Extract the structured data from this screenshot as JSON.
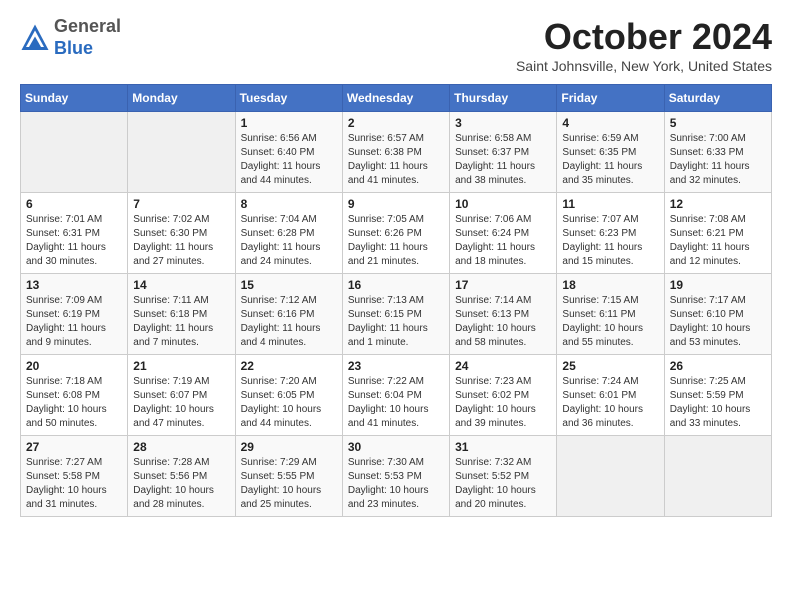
{
  "header": {
    "logo_line1": "General",
    "logo_line2": "Blue",
    "month_title": "October 2024",
    "location": "Saint Johnsville, New York, United States"
  },
  "weekdays": [
    "Sunday",
    "Monday",
    "Tuesday",
    "Wednesday",
    "Thursday",
    "Friday",
    "Saturday"
  ],
  "weeks": [
    [
      {
        "day": "",
        "sunrise": "",
        "sunset": "",
        "daylight": ""
      },
      {
        "day": "",
        "sunrise": "",
        "sunset": "",
        "daylight": ""
      },
      {
        "day": "1",
        "sunrise": "Sunrise: 6:56 AM",
        "sunset": "Sunset: 6:40 PM",
        "daylight": "Daylight: 11 hours and 44 minutes."
      },
      {
        "day": "2",
        "sunrise": "Sunrise: 6:57 AM",
        "sunset": "Sunset: 6:38 PM",
        "daylight": "Daylight: 11 hours and 41 minutes."
      },
      {
        "day": "3",
        "sunrise": "Sunrise: 6:58 AM",
        "sunset": "Sunset: 6:37 PM",
        "daylight": "Daylight: 11 hours and 38 minutes."
      },
      {
        "day": "4",
        "sunrise": "Sunrise: 6:59 AM",
        "sunset": "Sunset: 6:35 PM",
        "daylight": "Daylight: 11 hours and 35 minutes."
      },
      {
        "day": "5",
        "sunrise": "Sunrise: 7:00 AM",
        "sunset": "Sunset: 6:33 PM",
        "daylight": "Daylight: 11 hours and 32 minutes."
      }
    ],
    [
      {
        "day": "6",
        "sunrise": "Sunrise: 7:01 AM",
        "sunset": "Sunset: 6:31 PM",
        "daylight": "Daylight: 11 hours and 30 minutes."
      },
      {
        "day": "7",
        "sunrise": "Sunrise: 7:02 AM",
        "sunset": "Sunset: 6:30 PM",
        "daylight": "Daylight: 11 hours and 27 minutes."
      },
      {
        "day": "8",
        "sunrise": "Sunrise: 7:04 AM",
        "sunset": "Sunset: 6:28 PM",
        "daylight": "Daylight: 11 hours and 24 minutes."
      },
      {
        "day": "9",
        "sunrise": "Sunrise: 7:05 AM",
        "sunset": "Sunset: 6:26 PM",
        "daylight": "Daylight: 11 hours and 21 minutes."
      },
      {
        "day": "10",
        "sunrise": "Sunrise: 7:06 AM",
        "sunset": "Sunset: 6:24 PM",
        "daylight": "Daylight: 11 hours and 18 minutes."
      },
      {
        "day": "11",
        "sunrise": "Sunrise: 7:07 AM",
        "sunset": "Sunset: 6:23 PM",
        "daylight": "Daylight: 11 hours and 15 minutes."
      },
      {
        "day": "12",
        "sunrise": "Sunrise: 7:08 AM",
        "sunset": "Sunset: 6:21 PM",
        "daylight": "Daylight: 11 hours and 12 minutes."
      }
    ],
    [
      {
        "day": "13",
        "sunrise": "Sunrise: 7:09 AM",
        "sunset": "Sunset: 6:19 PM",
        "daylight": "Daylight: 11 hours and 9 minutes."
      },
      {
        "day": "14",
        "sunrise": "Sunrise: 7:11 AM",
        "sunset": "Sunset: 6:18 PM",
        "daylight": "Daylight: 11 hours and 7 minutes."
      },
      {
        "day": "15",
        "sunrise": "Sunrise: 7:12 AM",
        "sunset": "Sunset: 6:16 PM",
        "daylight": "Daylight: 11 hours and 4 minutes."
      },
      {
        "day": "16",
        "sunrise": "Sunrise: 7:13 AM",
        "sunset": "Sunset: 6:15 PM",
        "daylight": "Daylight: 11 hours and 1 minute."
      },
      {
        "day": "17",
        "sunrise": "Sunrise: 7:14 AM",
        "sunset": "Sunset: 6:13 PM",
        "daylight": "Daylight: 10 hours and 58 minutes."
      },
      {
        "day": "18",
        "sunrise": "Sunrise: 7:15 AM",
        "sunset": "Sunset: 6:11 PM",
        "daylight": "Daylight: 10 hours and 55 minutes."
      },
      {
        "day": "19",
        "sunrise": "Sunrise: 7:17 AM",
        "sunset": "Sunset: 6:10 PM",
        "daylight": "Daylight: 10 hours and 53 minutes."
      }
    ],
    [
      {
        "day": "20",
        "sunrise": "Sunrise: 7:18 AM",
        "sunset": "Sunset: 6:08 PM",
        "daylight": "Daylight: 10 hours and 50 minutes."
      },
      {
        "day": "21",
        "sunrise": "Sunrise: 7:19 AM",
        "sunset": "Sunset: 6:07 PM",
        "daylight": "Daylight: 10 hours and 47 minutes."
      },
      {
        "day": "22",
        "sunrise": "Sunrise: 7:20 AM",
        "sunset": "Sunset: 6:05 PM",
        "daylight": "Daylight: 10 hours and 44 minutes."
      },
      {
        "day": "23",
        "sunrise": "Sunrise: 7:22 AM",
        "sunset": "Sunset: 6:04 PM",
        "daylight": "Daylight: 10 hours and 41 minutes."
      },
      {
        "day": "24",
        "sunrise": "Sunrise: 7:23 AM",
        "sunset": "Sunset: 6:02 PM",
        "daylight": "Daylight: 10 hours and 39 minutes."
      },
      {
        "day": "25",
        "sunrise": "Sunrise: 7:24 AM",
        "sunset": "Sunset: 6:01 PM",
        "daylight": "Daylight: 10 hours and 36 minutes."
      },
      {
        "day": "26",
        "sunrise": "Sunrise: 7:25 AM",
        "sunset": "Sunset: 5:59 PM",
        "daylight": "Daylight: 10 hours and 33 minutes."
      }
    ],
    [
      {
        "day": "27",
        "sunrise": "Sunrise: 7:27 AM",
        "sunset": "Sunset: 5:58 PM",
        "daylight": "Daylight: 10 hours and 31 minutes."
      },
      {
        "day": "28",
        "sunrise": "Sunrise: 7:28 AM",
        "sunset": "Sunset: 5:56 PM",
        "daylight": "Daylight: 10 hours and 28 minutes."
      },
      {
        "day": "29",
        "sunrise": "Sunrise: 7:29 AM",
        "sunset": "Sunset: 5:55 PM",
        "daylight": "Daylight: 10 hours and 25 minutes."
      },
      {
        "day": "30",
        "sunrise": "Sunrise: 7:30 AM",
        "sunset": "Sunset: 5:53 PM",
        "daylight": "Daylight: 10 hours and 23 minutes."
      },
      {
        "day": "31",
        "sunrise": "Sunrise: 7:32 AM",
        "sunset": "Sunset: 5:52 PM",
        "daylight": "Daylight: 10 hours and 20 minutes."
      },
      {
        "day": "",
        "sunrise": "",
        "sunset": "",
        "daylight": ""
      },
      {
        "day": "",
        "sunrise": "",
        "sunset": "",
        "daylight": ""
      }
    ]
  ]
}
